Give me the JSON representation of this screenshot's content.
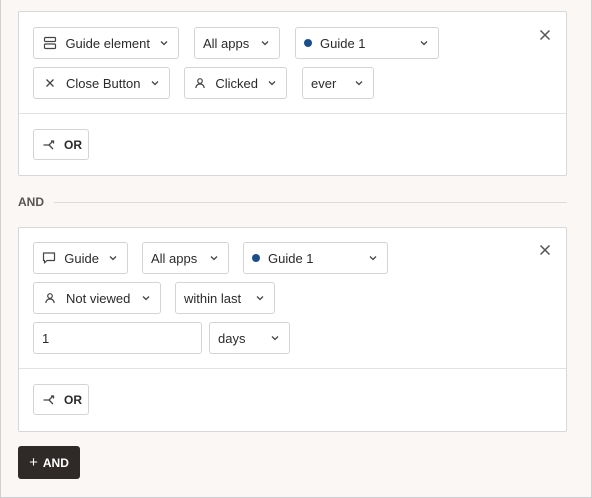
{
  "colors": {
    "dot": "#1b4f8c",
    "primary_button": "#2f2a27",
    "background": "#faf7f5"
  },
  "group1": {
    "filters": {
      "target_type": "Guide element",
      "app": "All apps",
      "guide": "Guide 1",
      "element": "Close Button",
      "action": "Clicked",
      "time": "ever"
    },
    "or_label": "OR",
    "icons": {
      "target_type": "layout-icon",
      "element": "x-icon",
      "action": "user-icon",
      "close": "close-icon",
      "or": "branch-icon"
    }
  },
  "and_divider_label": "AND",
  "group2": {
    "filters": {
      "target_type": "Guide",
      "app": "All apps",
      "guide": "Guide 1",
      "action": "Not viewed",
      "time": "within last",
      "amount_value": "1",
      "unit": "days"
    },
    "or_label": "OR",
    "icons": {
      "target_type": "message-icon",
      "action": "user-icon",
      "close": "close-icon",
      "or": "branch-icon"
    }
  },
  "add_and_label": "AND"
}
